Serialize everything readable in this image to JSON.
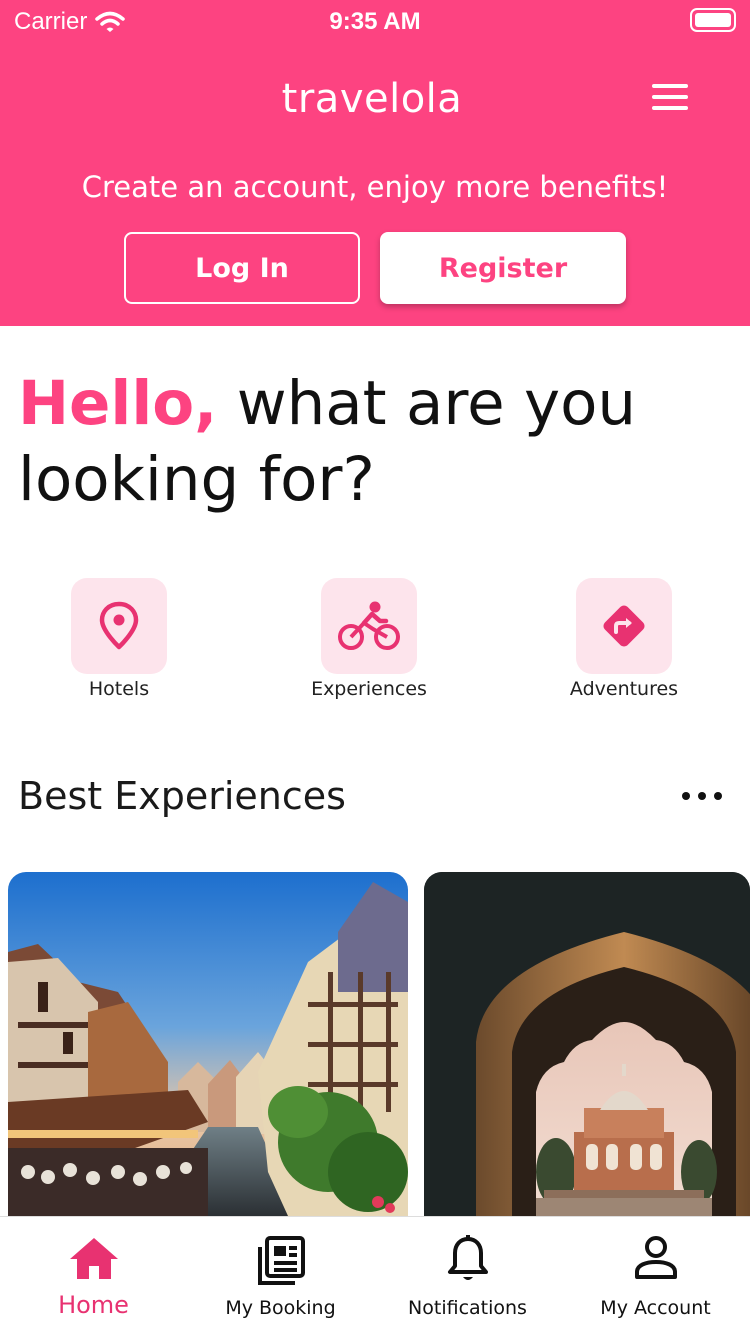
{
  "status_bar": {
    "carrier": "Carrier",
    "time": "9:35 AM"
  },
  "header": {
    "app_title": "travelola",
    "promo": "Create an account, enjoy more benefits!",
    "login_label": "Log In",
    "register_label": "Register",
    "brand_color": "#fd4381"
  },
  "greeting": {
    "accent": "Hello,",
    "rest": " what are you looking for?"
  },
  "categories": [
    {
      "label": "Hotels",
      "icon": "location-pin-icon"
    },
    {
      "label": "Experiences",
      "icon": "bicycle-icon"
    },
    {
      "label": "Adventures",
      "icon": "direction-sign-icon"
    }
  ],
  "section": {
    "title": "Best Experiences"
  },
  "tabs": [
    {
      "label": "Home",
      "icon": "home-icon",
      "active": true
    },
    {
      "label": "My Booking",
      "icon": "booking-icon"
    },
    {
      "label": "Notifications",
      "icon": "bell-icon"
    },
    {
      "label": "My Account",
      "icon": "account-icon"
    }
  ]
}
